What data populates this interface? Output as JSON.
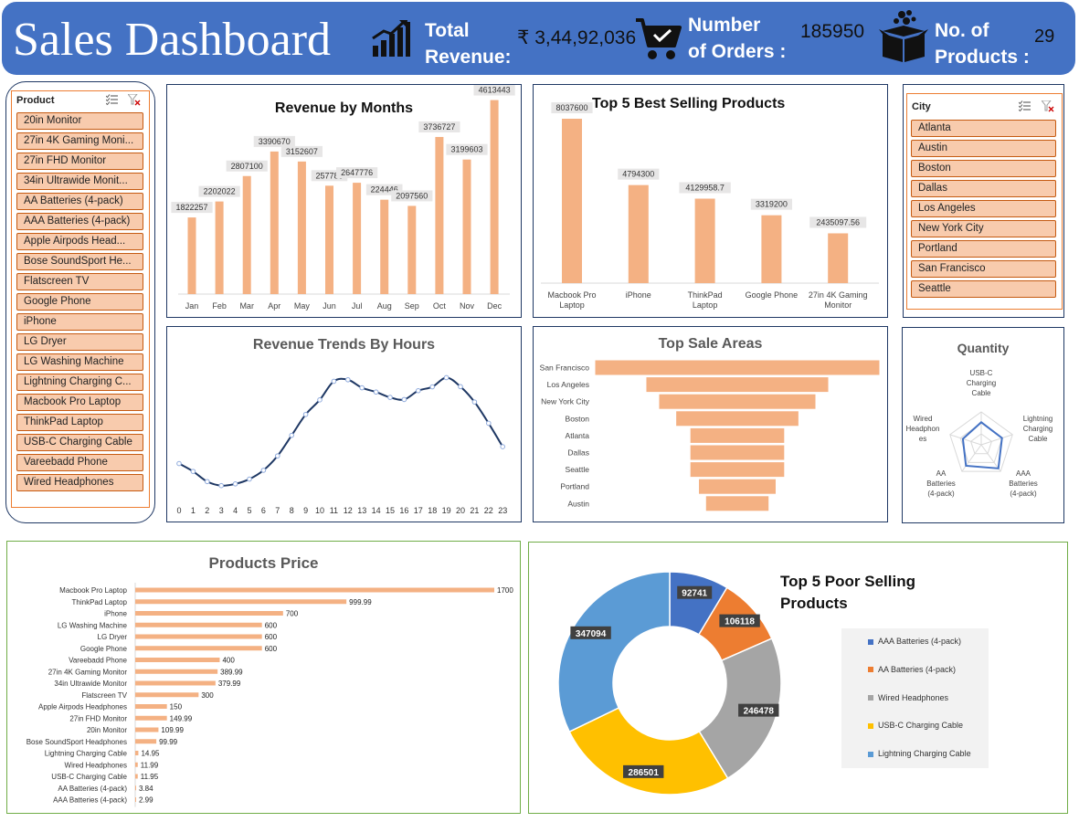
{
  "header": {
    "title": "Sales Dashboard",
    "kpis": [
      {
        "label_line1": "Total",
        "label_line2": "Revenue:",
        "value": "₹ 3,44,92,036",
        "icon": "bar-chart-icon"
      },
      {
        "label_line1": "Number",
        "label_line2": "of Orders :",
        "value": "185950",
        "icon": "shopping-cart-icon"
      },
      {
        "label_line1": "No. of",
        "label_line2": "Products :",
        "value": "29",
        "icon": "product-box-icon"
      }
    ]
  },
  "product_slicer": {
    "header": "Product",
    "items": [
      "20in Monitor",
      "27in 4K Gaming Moni...",
      "27in FHD Monitor",
      "34in Ultrawide Monit...",
      "AA Batteries (4-pack)",
      "AAA Batteries (4-pack)",
      "Apple Airpods Head...",
      "Bose SoundSport He...",
      "Flatscreen TV",
      "Google Phone",
      "iPhone",
      "LG Dryer",
      "LG Washing Machine",
      "Lightning Charging C...",
      "Macbook Pro Laptop",
      "ThinkPad Laptop",
      "USB-C Charging Cable",
      "Vareebadd Phone",
      "Wired Headphones"
    ]
  },
  "city_slicer": {
    "header": "City",
    "items": [
      "Atlanta",
      "Austin",
      "Boston",
      "Dallas",
      "Los Angeles",
      "New York City",
      "Portland",
      "San Francisco",
      "Seattle"
    ]
  },
  "colors": {
    "header_bg": "#4472c4",
    "bar": "#f4b183",
    "slicer_item": "#f8cbad",
    "line": "#1f3864"
  },
  "chart_data": [
    {
      "id": "months",
      "type": "bar",
      "title": "Revenue by Months",
      "categories": [
        "Jan",
        "Feb",
        "Mar",
        "Apr",
        "May",
        "Jun",
        "Jul",
        "Aug",
        "Sep",
        "Oct",
        "Nov",
        "Dec"
      ],
      "values": [
        1822257,
        2202022,
        2807100,
        3390670,
        3152607,
        2577802,
        2647776,
        2244468,
        2097560,
        3736727,
        3199603,
        4613443
      ],
      "labels": [
        "1822257",
        "2202022",
        "2807100",
        "3390670",
        "3152607",
        "257780",
        "2647776",
        "224446",
        "2097560",
        "3736727",
        "3199603",
        "4613443"
      ],
      "ylim": [
        0,
        4800000
      ]
    },
    {
      "id": "top5",
      "type": "bar",
      "title": "Top 5 Best Selling Products",
      "categories": [
        "Macbook Pro Laptop",
        "iPhone",
        "ThinkPad Laptop",
        "Google Phone",
        "27in 4K Gaming Monitor"
      ],
      "values": [
        8037600,
        4794300,
        4129958.7,
        3319200,
        2435097.56
      ],
      "labels": [
        "8037600",
        "4794300",
        "4129958.7",
        "3319200",
        "2435097.56"
      ],
      "ylim": [
        0,
        8500000
      ]
    },
    {
      "id": "hours",
      "type": "line",
      "title": "Revenue Trends By Hours",
      "x": [
        0,
        1,
        2,
        3,
        4,
        5,
        6,
        7,
        8,
        9,
        10,
        11,
        12,
        13,
        14,
        15,
        16,
        17,
        18,
        19,
        20,
        21,
        22,
        23
      ],
      "values": [
        145,
        104,
        51,
        30,
        39,
        64,
        110,
        185,
        292,
        401,
        477,
        574,
        582,
        540,
        518,
        490,
        479,
        525,
        545,
        593,
        546,
        466,
        355,
        233
      ]
    },
    {
      "id": "areas",
      "type": "bar",
      "orientation": "horizontal",
      "title": "Top Sale Areas",
      "categories": [
        "San Francisco",
        "Los Angeles",
        "New York City",
        "Boston",
        "Atlanta",
        "Dallas",
        "Seattle",
        "Portland",
        "Austin"
      ],
      "values": [
        100,
        64,
        55,
        43,
        33,
        33,
        33,
        27,
        22
      ]
    },
    {
      "id": "quantity",
      "type": "radar",
      "title": "Quantity",
      "categories": [
        "USB-C Charging Cable",
        "Lightning Charging Cable",
        "AAA Batteries (4-pack)",
        "AA Batteries (4-pack)",
        "Wired Headphones"
      ],
      "category_lines": [
        [
          "USB-C",
          "Charging",
          "Cable"
        ],
        [
          "Lightning",
          "Charging",
          "Cable"
        ],
        [
          "AAA",
          "Batteries",
          "(4-pack)"
        ],
        [
          "AA",
          "Batteries",
          "(4-pack)"
        ],
        [
          "Wired",
          "Headphon",
          "es"
        ]
      ],
      "values": [
        23975,
        23217,
        31017,
        27635,
        20557
      ],
      "rmax": 35000
    },
    {
      "id": "price",
      "type": "bar",
      "orientation": "horizontal",
      "title": "Products Price",
      "categories": [
        "Macbook Pro Laptop",
        "ThinkPad Laptop",
        "iPhone",
        "LG Washing Machine",
        "LG Dryer",
        "Google Phone",
        "Vareebadd Phone",
        "27in 4K Gaming Monitor",
        "34in Ultrawide Monitor",
        "Flatscreen TV",
        "Apple Airpods Headphones",
        "27in FHD Monitor",
        "20in Monitor",
        "Bose SoundSport Headphones",
        "Lightning Charging Cable",
        "Wired Headphones",
        "USB-C Charging Cable",
        "AA Batteries (4-pack)",
        "AAA Batteries (4-pack)"
      ],
      "values": [
        1700,
        999.99,
        700,
        600,
        600,
        600,
        400,
        389.99,
        379.99,
        300,
        150,
        149.99,
        109.99,
        99.99,
        14.95,
        11.99,
        11.95,
        3.84,
        2.99
      ],
      "labels": [
        "1700",
        "999.99",
        "700",
        "600",
        "600",
        "600",
        "400",
        "389.99",
        "379.99",
        "300",
        "150",
        "149.99",
        "109.99",
        "99.99",
        "14.95",
        "11.99",
        "11.95",
        "3.84",
        "2.99"
      ],
      "xlim": [
        0,
        1700
      ]
    },
    {
      "id": "poor",
      "type": "pie",
      "title_line1": "Top 5 Poor Selling",
      "title_line2": "Products",
      "slices": [
        {
          "name": "AAA Batteries (4-pack)",
          "value": 92741,
          "color": "#4472c4"
        },
        {
          "name": "AA Batteries (4-pack)",
          "value": 106118,
          "color": "#ed7d31"
        },
        {
          "name": "Wired Headphones",
          "value": 246478,
          "color": "#a5a5a5"
        },
        {
          "name": "USB-C Charging Cable",
          "value": 286501,
          "color": "#ffc000"
        },
        {
          "name": "Lightning Charging Cable",
          "value": 347094,
          "color": "#5b9bd5"
        }
      ]
    }
  ]
}
